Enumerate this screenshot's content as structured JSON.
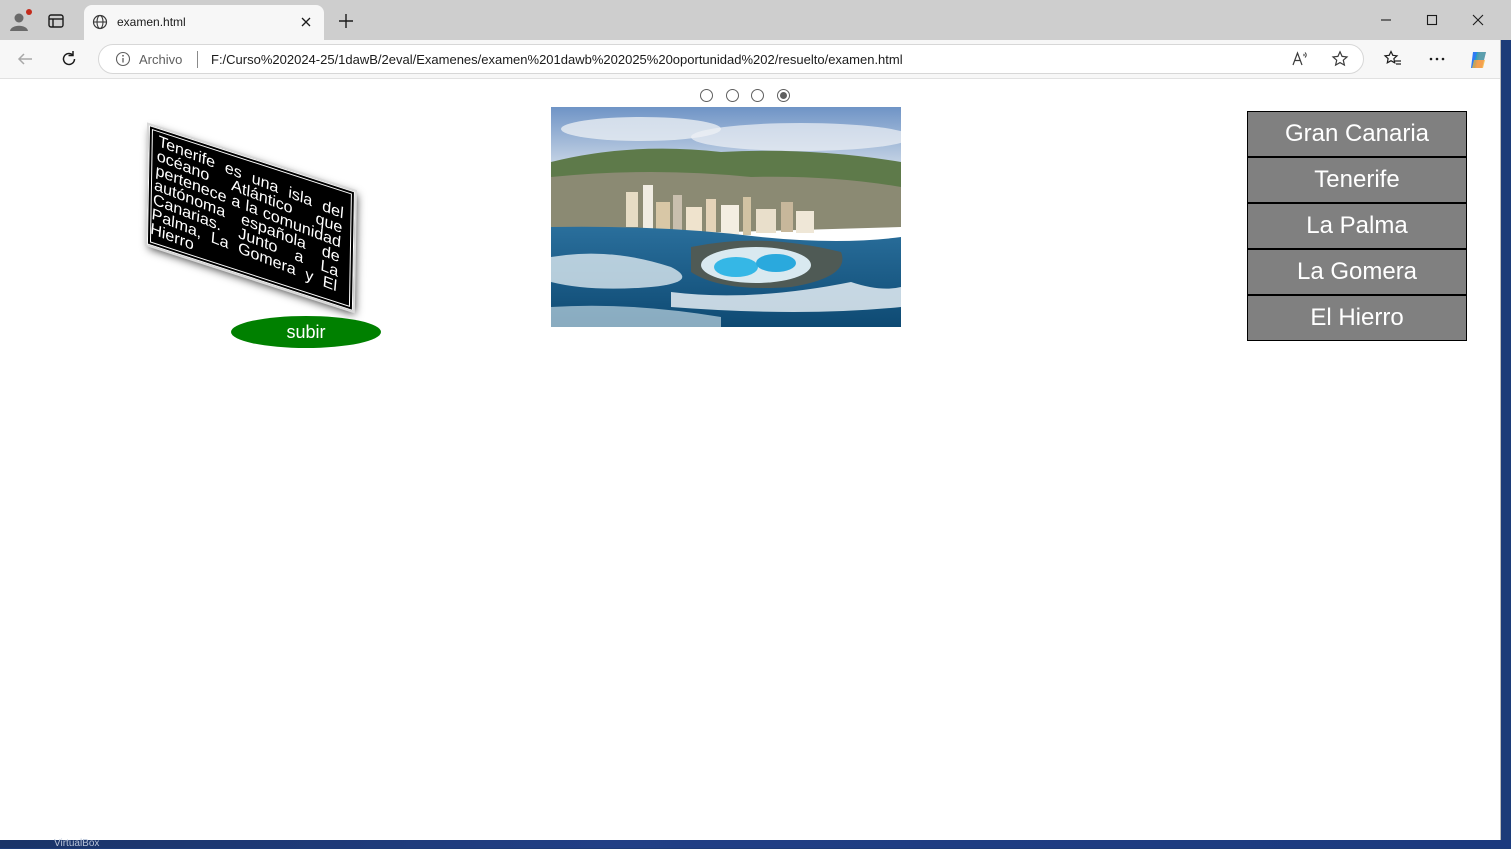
{
  "browser": {
    "tab_title": "examen.html",
    "address_prefix": "Archivo",
    "url": "F:/Curso%202024-25/1dawB/2eval/Examenes/examen%201dawb%202025%20oportunidad%202/resuelto/examen.html"
  },
  "page": {
    "info_text": "Tenerife es una isla del océano Atlántico que pertenece a la comunidad autónoma española de Canarias. Junto a La Palma, La Gomera y El Hierro",
    "subir_label": "subir",
    "slides": {
      "count": 4,
      "selected_index": 3
    },
    "islands": [
      "Gran Canaria",
      "Tenerife",
      "La Palma",
      "La Gomera",
      "El Hierro"
    ]
  },
  "taskbar": {
    "label": "VirtualBox"
  },
  "colors": {
    "subir_bg": "#008000",
    "menu_bg": "#808080",
    "info_bg": "#000000"
  }
}
